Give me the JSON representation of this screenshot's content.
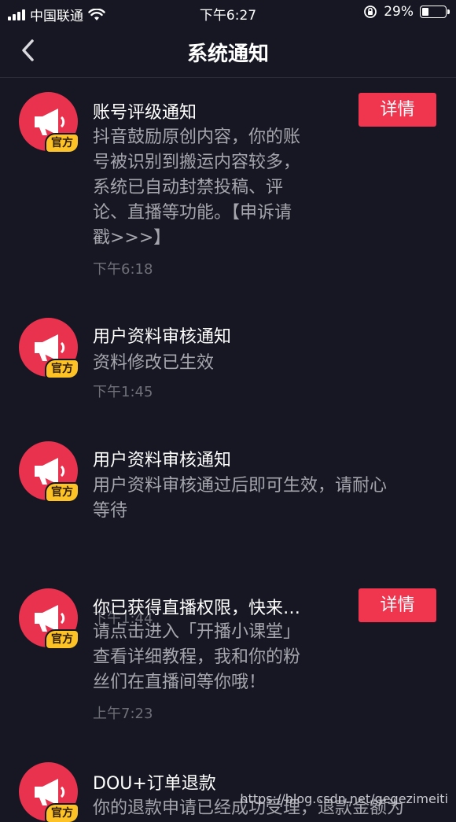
{
  "status_bar": {
    "carrier": "中国联通",
    "time": "下午6:27",
    "battery_text": "29%",
    "battery_level": 0.29
  },
  "header": {
    "title": "系统通知"
  },
  "notifications": [
    {
      "badge": "官方",
      "title": "账号评级通知",
      "body": [
        "抖音鼓励原创内容，你的账",
        "号被识别到搬运内容较多，",
        "系统已自动封禁投稿、评",
        "论、直播等功能。【申诉请",
        "戳>>>】"
      ],
      "time": "下午6:18",
      "button": "详情"
    },
    {
      "badge": "官方",
      "title": "用户资料审核通知",
      "body": [
        "资料修改已生效"
      ],
      "time": "下午1:45"
    },
    {
      "badge": "官方",
      "title": "用户资料审核通知",
      "body": [
        "用户资料审核通过后即可生效，请耐心",
        "等待"
      ],
      "time": "下午1:44"
    },
    {
      "badge": "官方",
      "title": "你已获得直播权限，快来…",
      "body": [
        "请点击进入「开播小课堂」",
        "查看详细教程，我和你的粉",
        "丝们在直播间等你哦！"
      ],
      "time": "上午7:23",
      "button": "详情"
    },
    {
      "badge": "官方",
      "title": "DOU+订单退款",
      "body": [
        "你的退款申请已经成功受理，退款金额为"
      ]
    }
  ],
  "watermark": "https://blog.csdn.net/gegezimeiti",
  "colors": {
    "background": "#161722",
    "avatar": "#e8324e",
    "badge": "#fdc326",
    "button": "#f0354f"
  }
}
